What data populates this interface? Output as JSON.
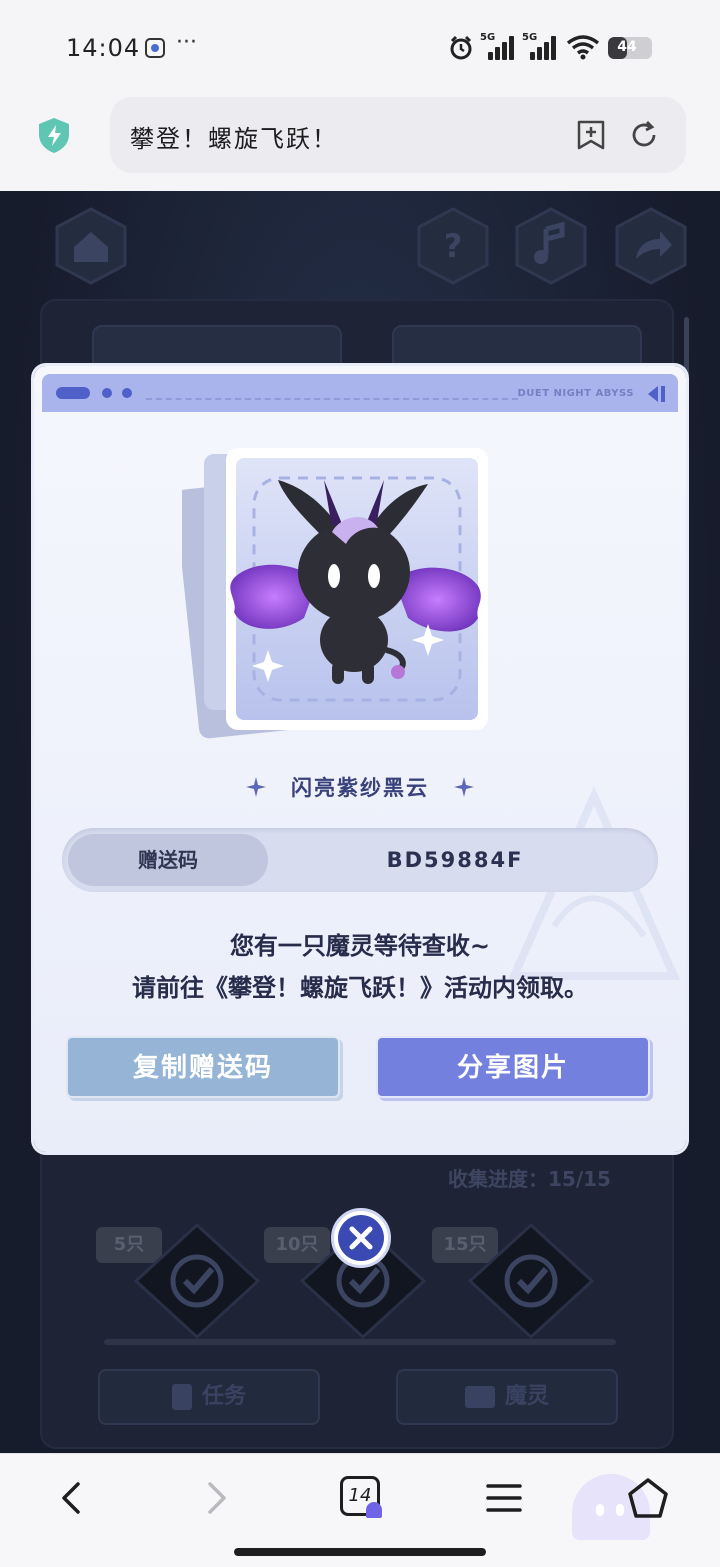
{
  "status_bar": {
    "time": "14:04",
    "more": "···",
    "network1": "5G",
    "network2": "5G",
    "battery": "44",
    "battery_level": 0.44
  },
  "browser": {
    "page_title": "攀登！螺旋飞跃！",
    "tab_count": "14",
    "accent_color": "#6f63e6"
  },
  "game": {
    "progress_text": "收集进度：15/15",
    "milestones": [
      "5只",
      "10只",
      "15只"
    ],
    "tabs": [
      "任务",
      "魔灵"
    ]
  },
  "modal": {
    "brand": "DUET NIGHT ABYSS",
    "creature_name": "闪亮紫纱黑云",
    "code_label": "赠送码",
    "code_value": "BD59884F",
    "message_line1": "您有一只魔灵等待查收~",
    "message_line2": "请前往《攀登！螺旋飞跃！》活动内领取。",
    "copy_button": "复制赠送码",
    "share_button": "分享图片",
    "copy_color": "#96b5d6",
    "share_color": "#7480de"
  }
}
